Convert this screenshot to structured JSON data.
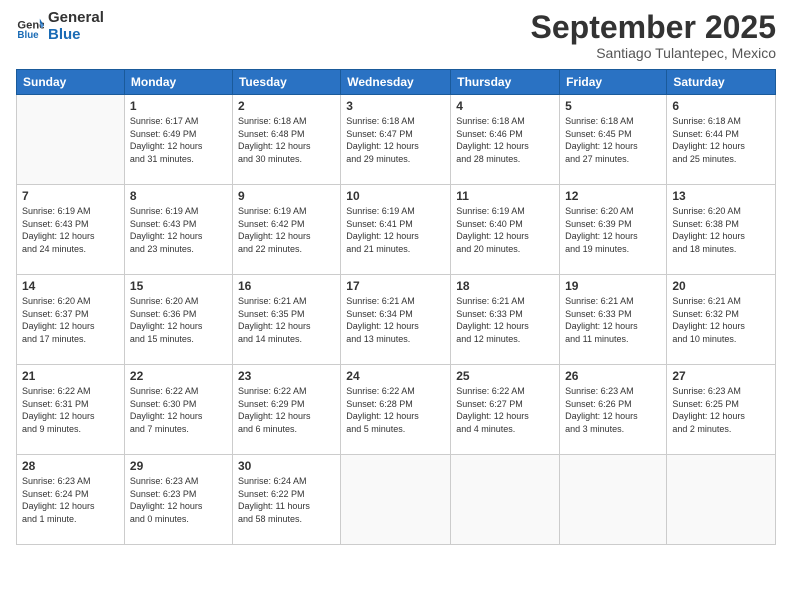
{
  "logo": {
    "line1": "General",
    "line2": "Blue"
  },
  "title": "September 2025",
  "subtitle": "Santiago Tulantepec, Mexico",
  "days_of_week": [
    "Sunday",
    "Monday",
    "Tuesday",
    "Wednesday",
    "Thursday",
    "Friday",
    "Saturday"
  ],
  "weeks": [
    [
      {
        "day": "",
        "info": ""
      },
      {
        "day": "1",
        "info": "Sunrise: 6:17 AM\nSunset: 6:49 PM\nDaylight: 12 hours\nand 31 minutes."
      },
      {
        "day": "2",
        "info": "Sunrise: 6:18 AM\nSunset: 6:48 PM\nDaylight: 12 hours\nand 30 minutes."
      },
      {
        "day": "3",
        "info": "Sunrise: 6:18 AM\nSunset: 6:47 PM\nDaylight: 12 hours\nand 29 minutes."
      },
      {
        "day": "4",
        "info": "Sunrise: 6:18 AM\nSunset: 6:46 PM\nDaylight: 12 hours\nand 28 minutes."
      },
      {
        "day": "5",
        "info": "Sunrise: 6:18 AM\nSunset: 6:45 PM\nDaylight: 12 hours\nand 27 minutes."
      },
      {
        "day": "6",
        "info": "Sunrise: 6:18 AM\nSunset: 6:44 PM\nDaylight: 12 hours\nand 25 minutes."
      }
    ],
    [
      {
        "day": "7",
        "info": "Sunrise: 6:19 AM\nSunset: 6:43 PM\nDaylight: 12 hours\nand 24 minutes."
      },
      {
        "day": "8",
        "info": "Sunrise: 6:19 AM\nSunset: 6:43 PM\nDaylight: 12 hours\nand 23 minutes."
      },
      {
        "day": "9",
        "info": "Sunrise: 6:19 AM\nSunset: 6:42 PM\nDaylight: 12 hours\nand 22 minutes."
      },
      {
        "day": "10",
        "info": "Sunrise: 6:19 AM\nSunset: 6:41 PM\nDaylight: 12 hours\nand 21 minutes."
      },
      {
        "day": "11",
        "info": "Sunrise: 6:19 AM\nSunset: 6:40 PM\nDaylight: 12 hours\nand 20 minutes."
      },
      {
        "day": "12",
        "info": "Sunrise: 6:20 AM\nSunset: 6:39 PM\nDaylight: 12 hours\nand 19 minutes."
      },
      {
        "day": "13",
        "info": "Sunrise: 6:20 AM\nSunset: 6:38 PM\nDaylight: 12 hours\nand 18 minutes."
      }
    ],
    [
      {
        "day": "14",
        "info": "Sunrise: 6:20 AM\nSunset: 6:37 PM\nDaylight: 12 hours\nand 17 minutes."
      },
      {
        "day": "15",
        "info": "Sunrise: 6:20 AM\nSunset: 6:36 PM\nDaylight: 12 hours\nand 15 minutes."
      },
      {
        "day": "16",
        "info": "Sunrise: 6:21 AM\nSunset: 6:35 PM\nDaylight: 12 hours\nand 14 minutes."
      },
      {
        "day": "17",
        "info": "Sunrise: 6:21 AM\nSunset: 6:34 PM\nDaylight: 12 hours\nand 13 minutes."
      },
      {
        "day": "18",
        "info": "Sunrise: 6:21 AM\nSunset: 6:33 PM\nDaylight: 12 hours\nand 12 minutes."
      },
      {
        "day": "19",
        "info": "Sunrise: 6:21 AM\nSunset: 6:33 PM\nDaylight: 12 hours\nand 11 minutes."
      },
      {
        "day": "20",
        "info": "Sunrise: 6:21 AM\nSunset: 6:32 PM\nDaylight: 12 hours\nand 10 minutes."
      }
    ],
    [
      {
        "day": "21",
        "info": "Sunrise: 6:22 AM\nSunset: 6:31 PM\nDaylight: 12 hours\nand 9 minutes."
      },
      {
        "day": "22",
        "info": "Sunrise: 6:22 AM\nSunset: 6:30 PM\nDaylight: 12 hours\nand 7 minutes."
      },
      {
        "day": "23",
        "info": "Sunrise: 6:22 AM\nSunset: 6:29 PM\nDaylight: 12 hours\nand 6 minutes."
      },
      {
        "day": "24",
        "info": "Sunrise: 6:22 AM\nSunset: 6:28 PM\nDaylight: 12 hours\nand 5 minutes."
      },
      {
        "day": "25",
        "info": "Sunrise: 6:22 AM\nSunset: 6:27 PM\nDaylight: 12 hours\nand 4 minutes."
      },
      {
        "day": "26",
        "info": "Sunrise: 6:23 AM\nSunset: 6:26 PM\nDaylight: 12 hours\nand 3 minutes."
      },
      {
        "day": "27",
        "info": "Sunrise: 6:23 AM\nSunset: 6:25 PM\nDaylight: 12 hours\nand 2 minutes."
      }
    ],
    [
      {
        "day": "28",
        "info": "Sunrise: 6:23 AM\nSunset: 6:24 PM\nDaylight: 12 hours\nand 1 minute."
      },
      {
        "day": "29",
        "info": "Sunrise: 6:23 AM\nSunset: 6:23 PM\nDaylight: 12 hours\nand 0 minutes."
      },
      {
        "day": "30",
        "info": "Sunrise: 6:24 AM\nSunset: 6:22 PM\nDaylight: 11 hours\nand 58 minutes."
      },
      {
        "day": "",
        "info": ""
      },
      {
        "day": "",
        "info": ""
      },
      {
        "day": "",
        "info": ""
      },
      {
        "day": "",
        "info": ""
      }
    ]
  ]
}
